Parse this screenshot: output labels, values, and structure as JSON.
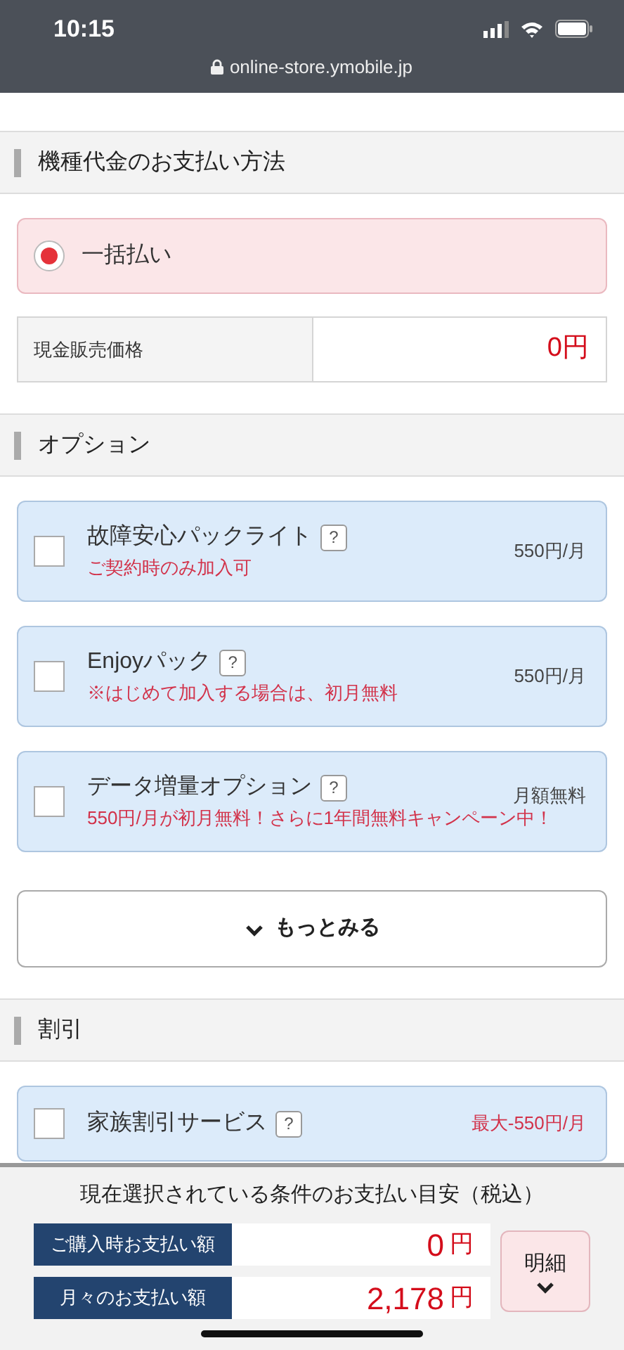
{
  "status_bar": {
    "time": "10:15",
    "url": "online-store.ymobile.jp"
  },
  "payment_section": {
    "title": "機種代金のお支払い方法",
    "methods": [
      {
        "label": "一括払い",
        "selected": true
      }
    ],
    "price_row": {
      "label": "現金販売価格",
      "value": "0円"
    }
  },
  "options_section": {
    "title": "オプション",
    "options": [
      {
        "name": "故障安心パックライト",
        "help": "?",
        "note": "ご契約時のみ加入可",
        "price": "550円/月",
        "checked": false
      },
      {
        "name": "Enjoyパック",
        "help": "?",
        "note": "※はじめて加入する場合は、初月無料",
        "price": "550円/月",
        "checked": false
      },
      {
        "name": "データ増量オプション",
        "help": "?",
        "note": "550円/月が初月無料！さらに1年間無料キャンペーン中！",
        "price": "月額無料",
        "checked": false
      }
    ],
    "more_button": "もっとみる"
  },
  "discount_section": {
    "title": "割引",
    "items": [
      {
        "name": "家族割引サービス",
        "help": "?",
        "price": "最大-550円/月",
        "checked": false
      }
    ]
  },
  "summary": {
    "title": "現在選択されている条件のお支払い目安（税込）",
    "rows": [
      {
        "label": "ご購入時お支払い額",
        "amount": "0",
        "unit": "円"
      },
      {
        "label": "月々のお支払い額",
        "amount": "2,178",
        "unit": "円"
      }
    ],
    "details_button": "明細"
  }
}
